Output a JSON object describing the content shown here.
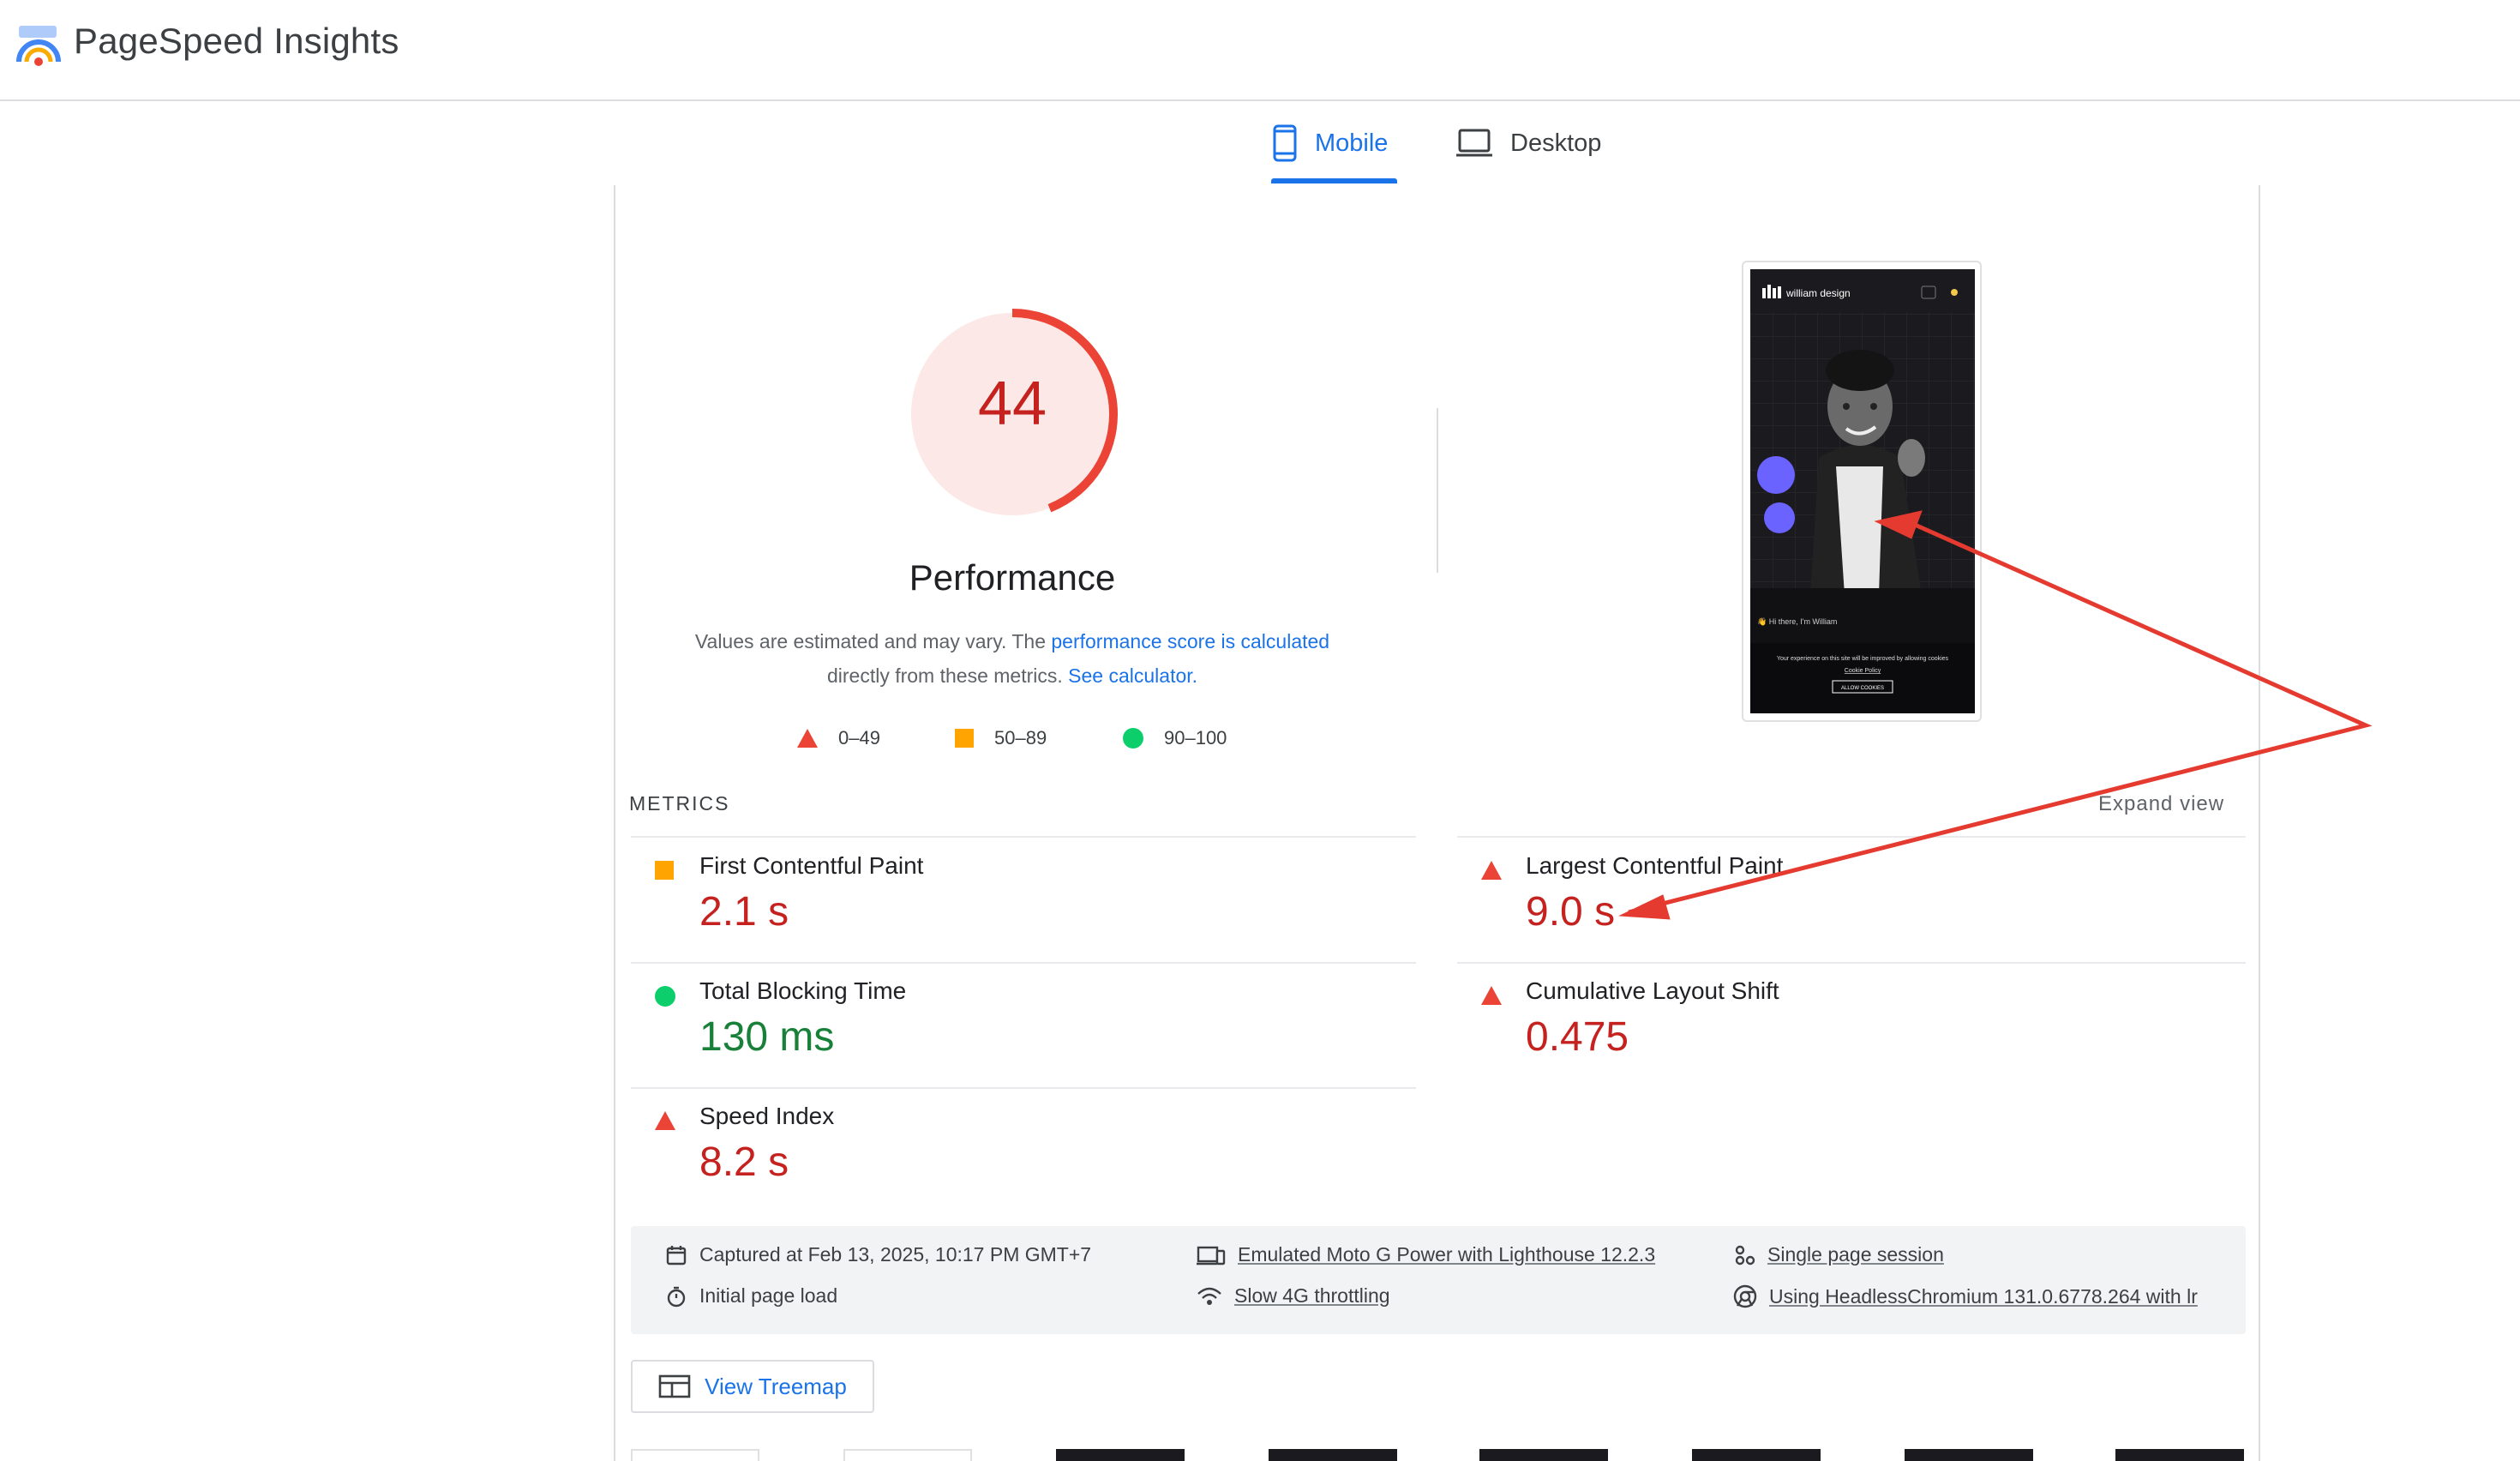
{
  "app": {
    "title": "PageSpeed Insights",
    "logo_icon": "pagespeed-logo-icon"
  },
  "tabs": [
    {
      "label": "Mobile",
      "icon": "smartphone-icon",
      "selected": true
    },
    {
      "label": "Desktop",
      "icon": "laptop-icon",
      "selected": false
    }
  ],
  "score": {
    "value": "44",
    "fraction": 0.44,
    "title": "Performance",
    "color": "#eb4335"
  },
  "description": {
    "prefix": "Values are estimated and may vary. The ",
    "link1": "performance score is calculated",
    "middle": "directly from these metrics. ",
    "link2": "See calculator."
  },
  "legend": [
    {
      "label": "0–49",
      "shape": "triangle",
      "color": "#eb4335"
    },
    {
      "label": "50–89",
      "shape": "square",
      "color": "#ffa400"
    },
    {
      "label": "90–100",
      "shape": "circle",
      "color": "#0cce6b"
    }
  ],
  "screenshot": {
    "brand": "william design",
    "greeting": "👋 Hi there, I'm William",
    "cookie_text": "Your experience on this site will be improved by allowing cookies",
    "cookie_link": "Cookie Policy",
    "cookie_button": "ALLOW COOKIES"
  },
  "metrics": {
    "heading": "METRICS",
    "expand": "Expand view",
    "items": [
      {
        "label": "First Contentful Paint",
        "value": "2.1 s",
        "status": "average"
      },
      {
        "label": "Largest Contentful Paint",
        "value": "9.0 s",
        "status": "fail"
      },
      {
        "label": "Total Blocking Time",
        "value": "130 ms",
        "status": "pass"
      },
      {
        "label": "Cumulative Layout Shift",
        "value": "0.475",
        "status": "fail"
      },
      {
        "label": "Speed Index",
        "value": "8.2 s",
        "status": "fail"
      }
    ]
  },
  "runtime": [
    {
      "icon": "calendar-icon",
      "text": "Captured at Feb 13, 2025, 10:17 PM GMT+7"
    },
    {
      "icon": "stopwatch-icon",
      "text": "Initial page load"
    },
    {
      "icon": "devices-icon",
      "text": "Emulated Moto G Power with Lighthouse 12.2.3"
    },
    {
      "icon": "network-icon",
      "text": "Slow 4G throttling"
    },
    {
      "icon": "session-icon",
      "text": "Single page session"
    },
    {
      "icon": "chrome-icon",
      "text": "Using HeadlessChromium 131.0.6778.264 with lr"
    }
  ],
  "treemap_button": "View Treemap",
  "annotation_color": "#e53a2f"
}
